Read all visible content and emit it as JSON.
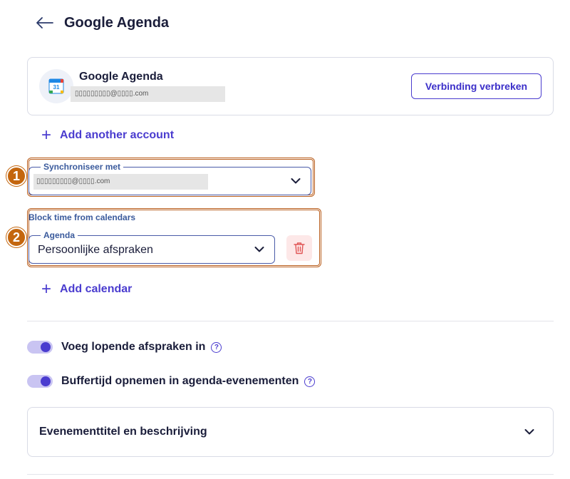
{
  "header": {
    "title": "Google Agenda"
  },
  "account": {
    "name": "Google Agenda",
    "email": "▯▯▯▯▯▯▯▯▯@▯▯▯▯.com",
    "logo_text": "31",
    "disconnect_label": "Verbinding verbreken"
  },
  "add_account_label": "Add another account",
  "sync": {
    "legend": "Synchroniseer met",
    "value": "▯▯▯▯▯▯▯▯▯@▯▯▯▯.com",
    "badge": "1"
  },
  "block_time": {
    "label": "Block time from calendars",
    "legend": "Agenda",
    "value": "Persoonlijke afspraken",
    "badge": "2"
  },
  "add_calendar_label": "Add calendar",
  "toggles": [
    {
      "label": "Voeg lopende afspraken in",
      "on": true
    },
    {
      "label": "Buffertijd opnemen in agenda-evenementen",
      "on": true
    }
  ],
  "help_glyph": "?",
  "accordion": {
    "title": "Evenementtitel en beschrijving"
  },
  "colors": {
    "accent": "#4a3ccf",
    "highlight": "#c4660e",
    "danger": "#e05555"
  }
}
